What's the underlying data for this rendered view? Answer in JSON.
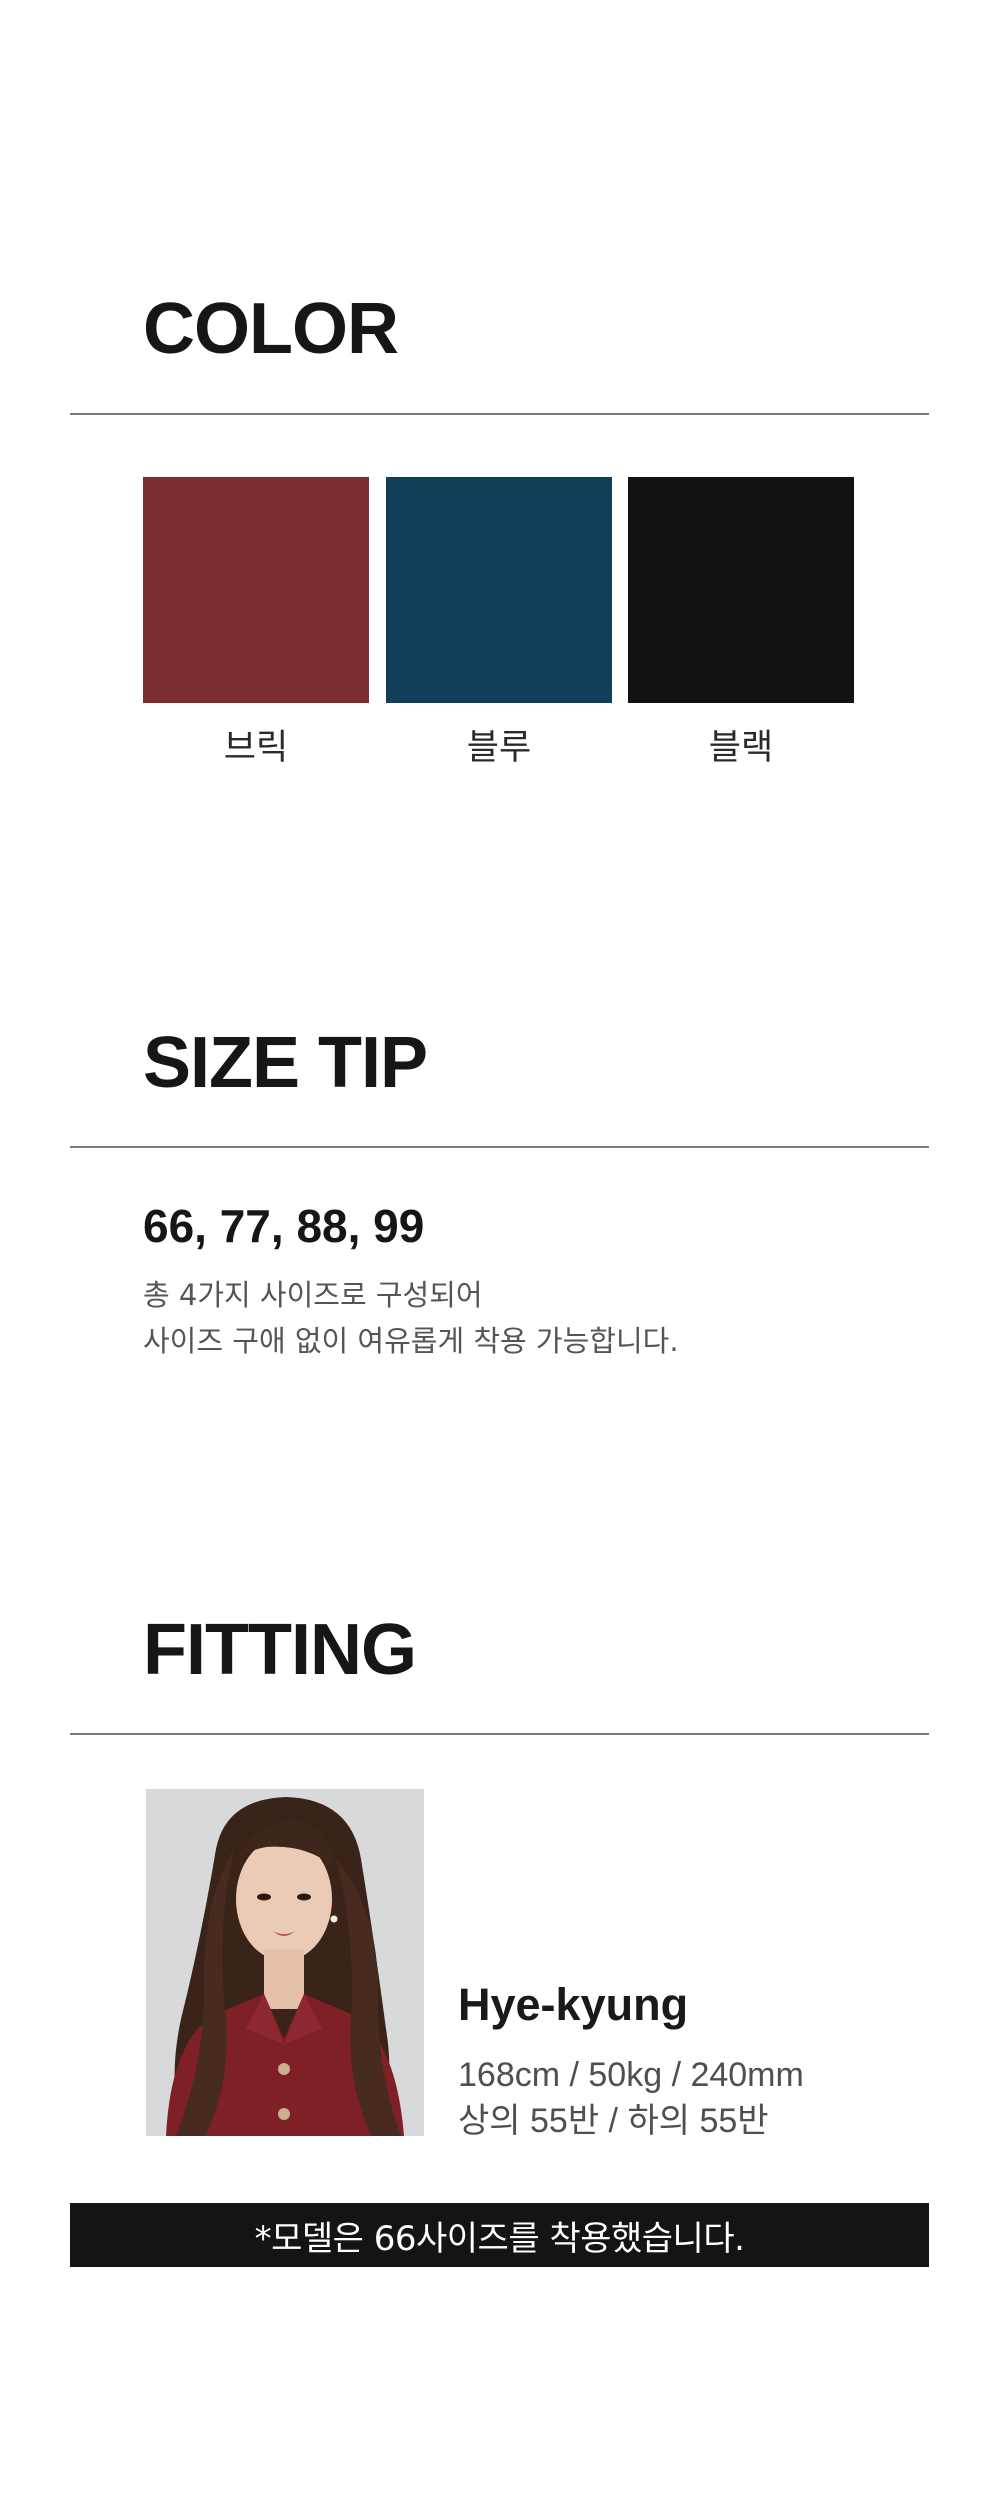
{
  "color_section": {
    "title": "COLOR",
    "swatches": [
      {
        "label": "브릭",
        "color": "#7b2e30"
      },
      {
        "label": "블루",
        "color": "#113e58"
      },
      {
        "label": "블랙",
        "color": "#121212"
      }
    ]
  },
  "size_section": {
    "title": "SIZE TIP",
    "sizes": "66, 77, 88, 99",
    "description_line1": "총 4가지 사이즈로 구성되어",
    "description_line2": "사이즈 구애 없이 여유롭게 착용 가능합니다."
  },
  "fitting_section": {
    "title": "FITTING",
    "model": {
      "name": "Hye-kyung",
      "measurements": "168cm / 50kg / 240mm",
      "sizes_worn": "상의 55반 / 하의 55반"
    },
    "notice": "*모델은 66사이즈를 착용했습니다."
  },
  "colors": {
    "divider": "#7a7a7a",
    "notice_background": "#141414",
    "photo_top": "#7f1f26"
  }
}
